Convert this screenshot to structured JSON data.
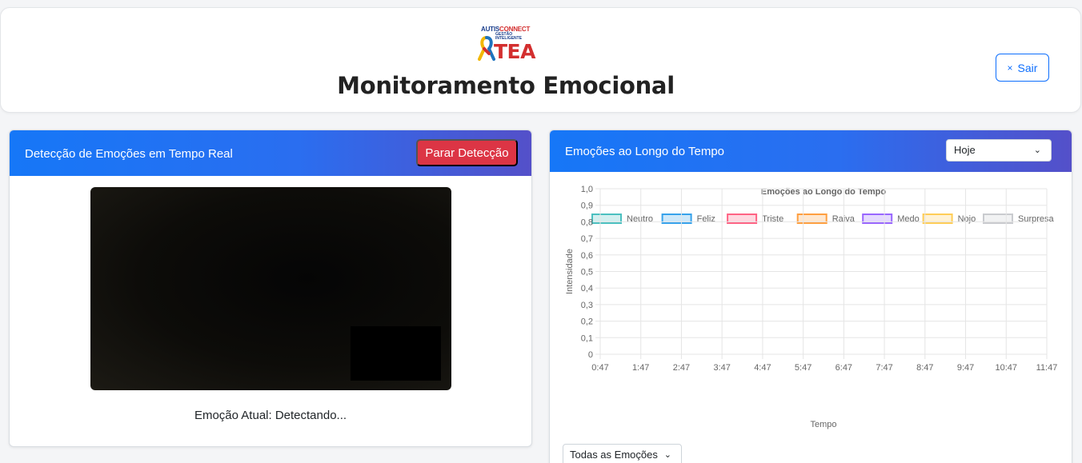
{
  "header": {
    "logo": {
      "brand_a": "AUTIS",
      "brand_b": "CONNECT",
      "tagline_1": "GESTÃO",
      "tagline_2": "INTELIGENTE",
      "word": "TEA"
    },
    "title": "Monitoramento Emocional",
    "logout_label": "Sair",
    "logout_icon": "close-icon"
  },
  "detection_panel": {
    "title": "Detecção de Emoções em Tempo Real",
    "stop_button": "Parar Detecção",
    "current_emotion": "Emoção Atual: Detectando..."
  },
  "timeline_panel": {
    "title": "Emoções ao Longo do Tempo",
    "range_selected": "Hoje",
    "filter_selected": "Todas as Emoções"
  },
  "chart_data": {
    "type": "line",
    "title": "Emoções ao Longo do Tempo",
    "xlabel": "Tempo",
    "ylabel": "Intensidade",
    "x": [
      "0:47",
      "1:47",
      "2:47",
      "3:47",
      "4:47",
      "5:47",
      "6:47",
      "7:47",
      "8:47",
      "9:47",
      "10:47",
      "11:47"
    ],
    "y_ticks": [
      "0",
      "0,1",
      "0,2",
      "0,3",
      "0,4",
      "0,5",
      "0,6",
      "0,7",
      "0,8",
      "0,9",
      "1,0"
    ],
    "ylim": [
      0,
      1
    ],
    "grid": true,
    "legend_position": "top",
    "series": [
      {
        "name": "Neutro",
        "color": "#4bc0c0",
        "values": []
      },
      {
        "name": "Feliz",
        "color": "#36a2eb",
        "values": []
      },
      {
        "name": "Triste",
        "color": "#ff6384",
        "values": []
      },
      {
        "name": "Raiva",
        "color": "#ff9f40",
        "values": []
      },
      {
        "name": "Medo",
        "color": "#9966ff",
        "values": []
      },
      {
        "name": "Nojo",
        "color": "#ffcd56",
        "values": []
      },
      {
        "name": "Surpresa",
        "color": "#c9cbcf",
        "values": []
      }
    ]
  }
}
